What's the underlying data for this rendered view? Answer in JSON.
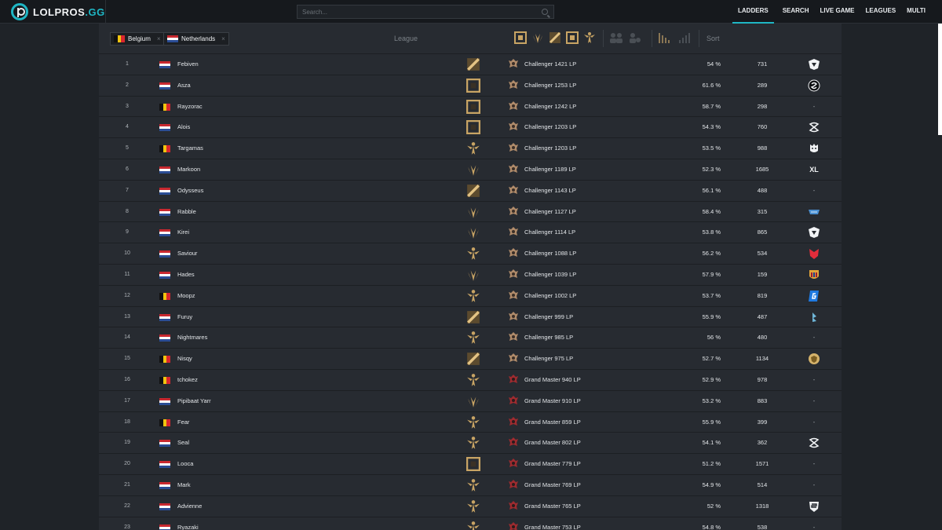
{
  "brand": {
    "name": "LOLPROS",
    "tld": ".GG"
  },
  "search": {
    "placeholder": "Search..."
  },
  "nav": [
    {
      "label": "LADDERS",
      "active": true
    },
    {
      "label": "SEARCH",
      "active": false
    },
    {
      "label": "LIVE GAME",
      "active": false
    },
    {
      "label": "LEAGUES",
      "active": false
    },
    {
      "label": "MULTI",
      "active": false
    }
  ],
  "filters": {
    "countries": [
      {
        "label": "Belgium",
        "flag": "be"
      },
      {
        "label": "Netherlands",
        "flag": "nl"
      }
    ],
    "league_placeholder": "League",
    "sort_placeholder": "Sort",
    "roles": [
      "top-icon",
      "jungle-icon",
      "mid-icon",
      "bottom-icon",
      "support-icon"
    ]
  },
  "colors": {
    "accent": "#1fb6c4",
    "role_gold": "#c8a464",
    "panel": "#272b31",
    "background": "#1f2328"
  },
  "rows": [
    {
      "rank": "1",
      "flag": "nl",
      "name": "Febiven",
      "role": "mid",
      "tier": "challenger",
      "lp": "Challenger 1421 LP",
      "winrate": "54 %",
      "games": "731",
      "team": "excel-logo"
    },
    {
      "rank": "2",
      "flag": "nl",
      "name": "Asza",
      "role": "top",
      "tier": "challenger",
      "lp": "Challenger 1253 LP",
      "winrate": "61.6 %",
      "games": "289",
      "team": "splyce-logo"
    },
    {
      "rank": "3",
      "flag": "be",
      "name": "Rayzorac",
      "role": "top",
      "tier": "challenger",
      "lp": "Challenger 1242 LP",
      "winrate": "58.7 %",
      "games": "298",
      "team": "-"
    },
    {
      "rank": "4",
      "flag": "nl",
      "name": "Alois",
      "role": "top",
      "tier": "challenger",
      "lp": "Challenger 1203 LP",
      "winrate": "54.3 %",
      "games": "760",
      "team": "sk-logo"
    },
    {
      "rank": "5",
      "flag": "be",
      "name": "Targamas",
      "role": "support",
      "tier": "challenger",
      "lp": "Challenger 1203 LP",
      "winrate": "53.5 %",
      "games": "988",
      "team": "g2-logo"
    },
    {
      "rank": "6",
      "flag": "nl",
      "name": "Markoon",
      "role": "jungle",
      "tier": "challenger",
      "lp": "Challenger 1189 LP",
      "winrate": "52.3 %",
      "games": "1685",
      "team": "XL"
    },
    {
      "rank": "7",
      "flag": "nl",
      "name": "Odysseus",
      "role": "mid",
      "tier": "challenger",
      "lp": "Challenger 1143 LP",
      "winrate": "56.1 %",
      "games": "488",
      "team": "-"
    },
    {
      "rank": "8",
      "flag": "nl",
      "name": "Rabble",
      "role": "jungle",
      "tier": "challenger",
      "lp": "Challenger 1127 LP",
      "winrate": "58.4 %",
      "games": "315",
      "team": "team-logo"
    },
    {
      "rank": "9",
      "flag": "nl",
      "name": "Kirei",
      "role": "jungle",
      "tier": "challenger",
      "lp": "Challenger 1114 LP",
      "winrate": "53.8 %",
      "games": "865",
      "team": "excel-logo"
    },
    {
      "rank": "10",
      "flag": "nl",
      "name": "Saviour",
      "role": "support",
      "tier": "challenger",
      "lp": "Challenger 1088 LP",
      "winrate": "56.2 %",
      "games": "534",
      "team": "mad-logo"
    },
    {
      "rank": "11",
      "flag": "nl",
      "name": "Hades",
      "role": "jungle",
      "tier": "challenger",
      "lp": "Challenger 1039 LP",
      "winrate": "57.9 %",
      "games": "159",
      "team": "barca-logo"
    },
    {
      "rank": "12",
      "flag": "be",
      "name": "Moopz",
      "role": "support",
      "tier": "challenger",
      "lp": "Challenger 1002 LP",
      "winrate": "53.7 %",
      "games": "819",
      "team": "giants-logo"
    },
    {
      "rank": "13",
      "flag": "nl",
      "name": "Furuy",
      "role": "mid",
      "tier": "challenger",
      "lp": "Challenger 999 LP",
      "winrate": "55.9 %",
      "games": "487",
      "team": "bulldog-logo"
    },
    {
      "rank": "14",
      "flag": "nl",
      "name": "Nightmares",
      "role": "support",
      "tier": "challenger",
      "lp": "Challenger 985 LP",
      "winrate": "56 %",
      "games": "480",
      "team": "-"
    },
    {
      "rank": "15",
      "flag": "be",
      "name": "Nisqy",
      "role": "mid",
      "tier": "challenger",
      "lp": "Challenger 975 LP",
      "winrate": "52.7 %",
      "games": "1134",
      "team": "mad-lions-logo"
    },
    {
      "rank": "16",
      "flag": "be",
      "name": "tchokez",
      "role": "support",
      "tier": "grandmaster",
      "lp": "Grand Master 940 LP",
      "winrate": "52.9 %",
      "games": "978",
      "team": "-"
    },
    {
      "rank": "17",
      "flag": "nl",
      "name": "Pipibaat Yarr",
      "role": "jungle",
      "tier": "grandmaster",
      "lp": "Grand Master 910 LP",
      "winrate": "53.2 %",
      "games": "883",
      "team": "-"
    },
    {
      "rank": "18",
      "flag": "be",
      "name": "Fear",
      "role": "support",
      "tier": "grandmaster",
      "lp": "Grand Master 859 LP",
      "winrate": "55.9 %",
      "games": "399",
      "team": "-"
    },
    {
      "rank": "19",
      "flag": "nl",
      "name": "Seal",
      "role": "support",
      "tier": "grandmaster",
      "lp": "Grand Master 802 LP",
      "winrate": "54.1 %",
      "games": "362",
      "team": "sk-logo"
    },
    {
      "rank": "20",
      "flag": "nl",
      "name": "Looca",
      "role": "top",
      "tier": "grandmaster",
      "lp": "Grand Master 779 LP",
      "winrate": "51.2 %",
      "games": "1571",
      "team": "-"
    },
    {
      "rank": "21",
      "flag": "nl",
      "name": "Mark",
      "role": "support",
      "tier": "grandmaster",
      "lp": "Grand Master 769 LP",
      "winrate": "54.9 %",
      "games": "514",
      "team": "-"
    },
    {
      "rank": "22",
      "flag": "nl",
      "name": "Advienne",
      "role": "support",
      "tier": "grandmaster",
      "lp": "Grand Master 765 LP",
      "winrate": "52 %",
      "games": "1318",
      "team": "shield-logo"
    },
    {
      "rank": "23",
      "flag": "nl",
      "name": "Ryazaki",
      "role": "support",
      "tier": "grandmaster",
      "lp": "Grand Master 753 LP",
      "winrate": "54.8 %",
      "games": "538",
      "team": "-"
    }
  ]
}
